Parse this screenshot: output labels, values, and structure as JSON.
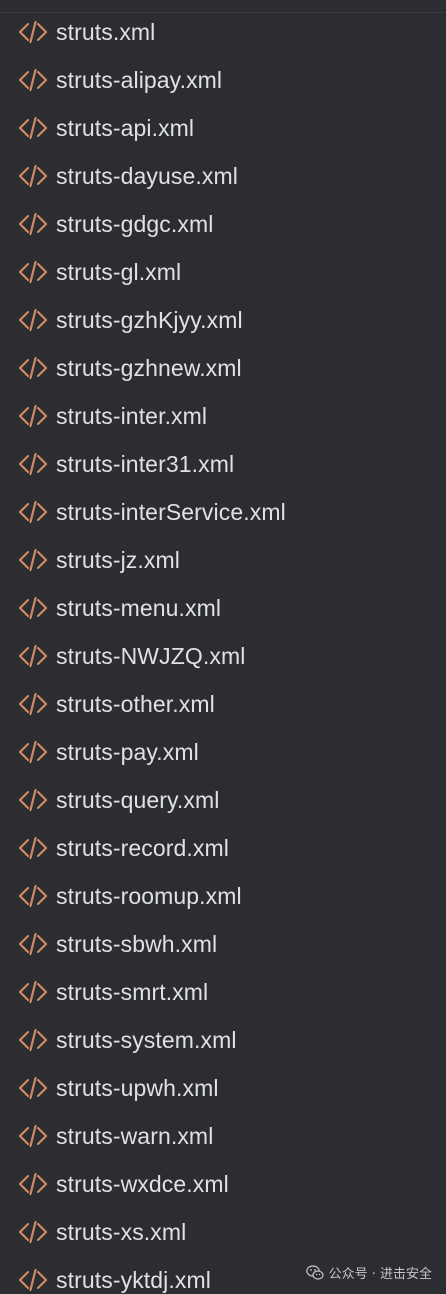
{
  "files": [
    {
      "name": "struts.xml",
      "icon": "xml-file-icon"
    },
    {
      "name": "struts-alipay.xml",
      "icon": "xml-file-icon"
    },
    {
      "name": "struts-api.xml",
      "icon": "xml-file-icon"
    },
    {
      "name": "struts-dayuse.xml",
      "icon": "xml-file-icon"
    },
    {
      "name": "struts-gdgc.xml",
      "icon": "xml-file-icon"
    },
    {
      "name": "struts-gl.xml",
      "icon": "xml-file-icon"
    },
    {
      "name": "struts-gzhKjyy.xml",
      "icon": "xml-file-icon"
    },
    {
      "name": "struts-gzhnew.xml",
      "icon": "xml-file-icon"
    },
    {
      "name": "struts-inter.xml",
      "icon": "xml-file-icon"
    },
    {
      "name": "struts-inter31.xml",
      "icon": "xml-file-icon"
    },
    {
      "name": "struts-interService.xml",
      "icon": "xml-file-icon"
    },
    {
      "name": "struts-jz.xml",
      "icon": "xml-file-icon"
    },
    {
      "name": "struts-menu.xml",
      "icon": "xml-file-icon"
    },
    {
      "name": "struts-NWJZQ.xml",
      "icon": "xml-file-icon"
    },
    {
      "name": "struts-other.xml",
      "icon": "xml-file-icon"
    },
    {
      "name": "struts-pay.xml",
      "icon": "xml-file-icon"
    },
    {
      "name": "struts-query.xml",
      "icon": "xml-file-icon"
    },
    {
      "name": "struts-record.xml",
      "icon": "xml-file-icon"
    },
    {
      "name": "struts-roomup.xml",
      "icon": "xml-file-icon"
    },
    {
      "name": "struts-sbwh.xml",
      "icon": "xml-file-icon"
    },
    {
      "name": "struts-smrt.xml",
      "icon": "xml-file-icon"
    },
    {
      "name": "struts-system.xml",
      "icon": "xml-file-icon"
    },
    {
      "name": "struts-upwh.xml",
      "icon": "xml-file-icon"
    },
    {
      "name": "struts-warn.xml",
      "icon": "xml-file-icon"
    },
    {
      "name": "struts-wxdce.xml",
      "icon": "xml-file-icon"
    },
    {
      "name": "struts-xs.xml",
      "icon": "xml-file-icon"
    },
    {
      "name": "struts-yktdj.xml",
      "icon": "xml-file-icon"
    }
  ],
  "colors": {
    "background": "#2b2d31",
    "text": "#dfe1e5",
    "icon": "#d08a63"
  },
  "watermark": {
    "text": "公众号 · 进击安全",
    "icon": "wechat-icon"
  }
}
